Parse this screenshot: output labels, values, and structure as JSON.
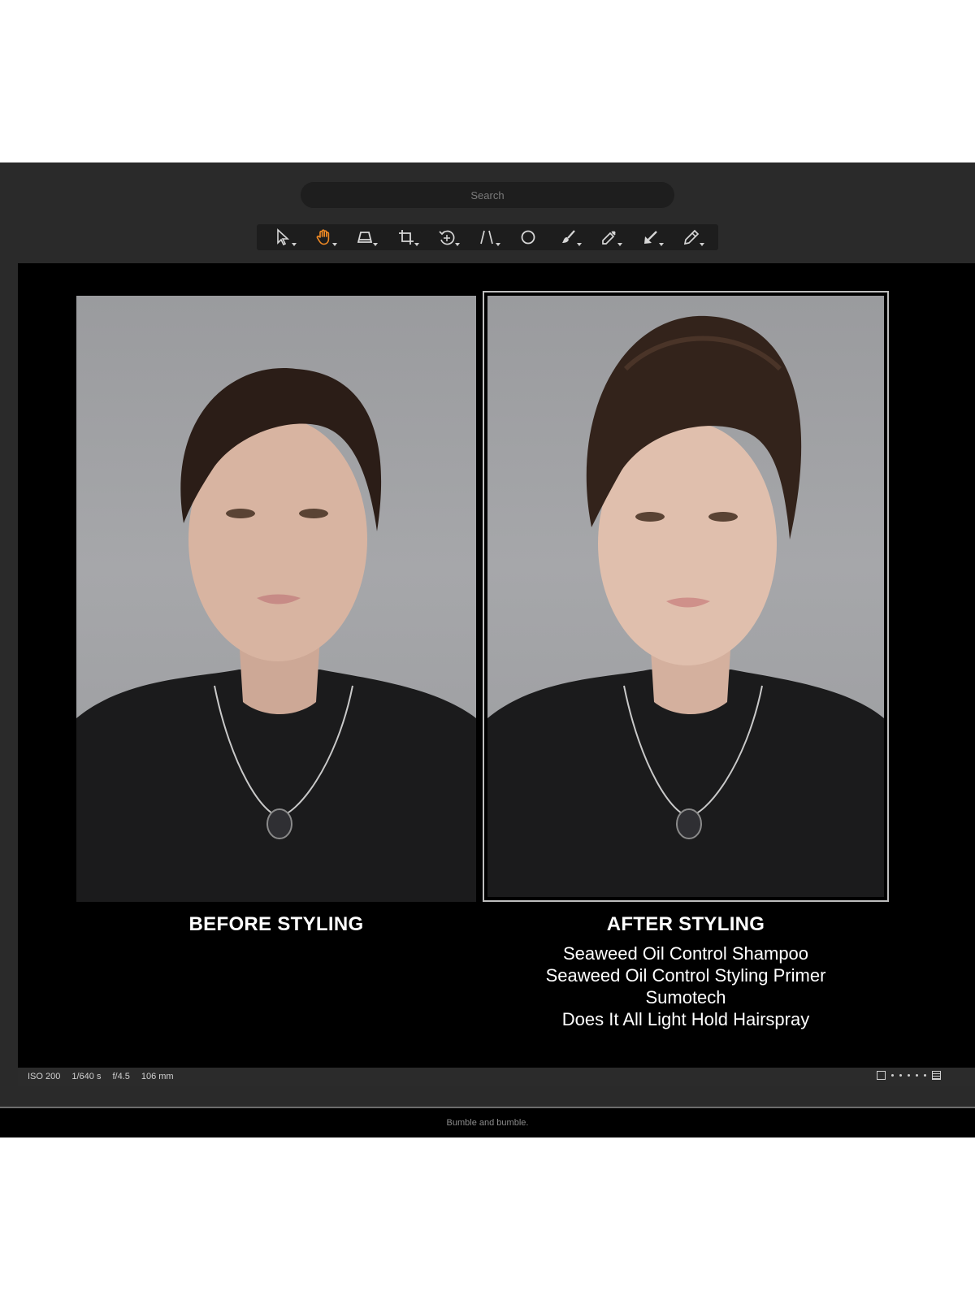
{
  "search": {
    "placeholder": "Search"
  },
  "toolbar": {
    "accent_color": "#f08a24",
    "tools": [
      {
        "name": "select-arrow-icon",
        "active": false
      },
      {
        "name": "hand-pan-icon",
        "active": true
      },
      {
        "name": "keystone-icon",
        "active": false
      },
      {
        "name": "crop-icon",
        "active": false
      },
      {
        "name": "rotate-icon",
        "active": false
      },
      {
        "name": "straighten-lines-icon",
        "active": false
      },
      {
        "name": "circle-mask-icon",
        "active": false
      },
      {
        "name": "brush-icon",
        "active": false
      },
      {
        "name": "eyedropper-icon",
        "active": false
      },
      {
        "name": "arrow-pick-icon",
        "active": false
      },
      {
        "name": "eraser-pencil-icon",
        "active": false
      }
    ]
  },
  "captions": {
    "before": "BEFORE STYLING",
    "after": "AFTER STYLING",
    "products": [
      "Seaweed Oil Control Shampoo",
      "Seaweed Oil Control Styling Primer",
      "Sumotech",
      "Does It All Light Hold Hairspray"
    ]
  },
  "status": {
    "iso": "ISO 200",
    "shutter": "1/640 s",
    "aperture": "f/4.5",
    "focal_length": "106 mm"
  },
  "footer": {
    "text": "Bumble and bumble."
  }
}
